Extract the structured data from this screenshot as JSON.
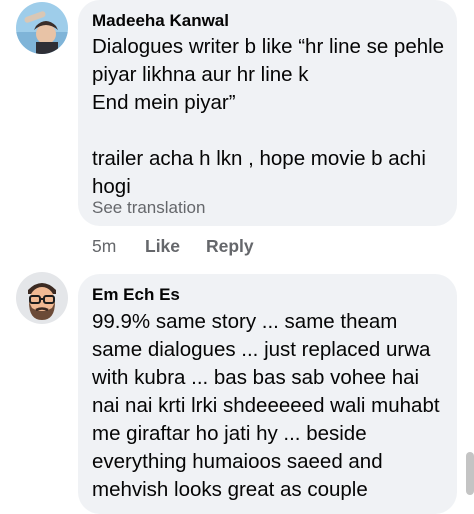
{
  "comments": [
    {
      "author": "Madeeha Kanwal",
      "text": "Dialogues writer b like “hr line se pehle piyar likhna aur hr line k\nEnd mein piyar”\n\ntrailer acha h lkn , hope movie b achi hogi",
      "translation_link": "See translation",
      "time": "5m",
      "like": "Like",
      "reply": "Reply"
    },
    {
      "author": "Em Ech Es",
      "text": "99.9% same story ... same theam same dialogues ... just replaced urwa with kubra ... bas bas sab vohee hai nai nai krti lrki shdeeeeed wali muhabt me giraftar ho jati hy ... beside everything humaioos saeed and mehvish looks great as couple"
    }
  ]
}
